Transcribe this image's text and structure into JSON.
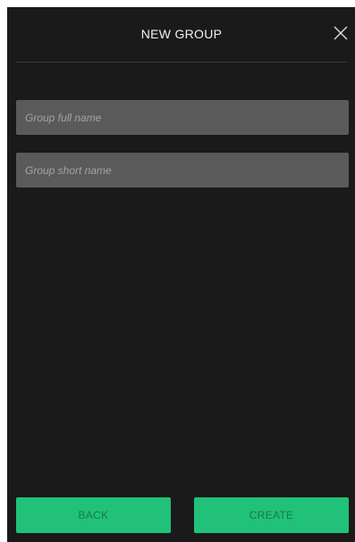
{
  "dialog": {
    "title": "NEW GROUP",
    "close_icon": "close-icon"
  },
  "form": {
    "full_name_placeholder": "Group full name",
    "full_name_value": "",
    "short_name_placeholder": "Group short name",
    "short_name_value": ""
  },
  "footer": {
    "back_label": "BACK",
    "create_label": "CREATE"
  },
  "colors": {
    "background": "#1a1a1a",
    "field": "#5a5a5a",
    "accent": "#21c17a",
    "button_text": "#167a4c"
  }
}
